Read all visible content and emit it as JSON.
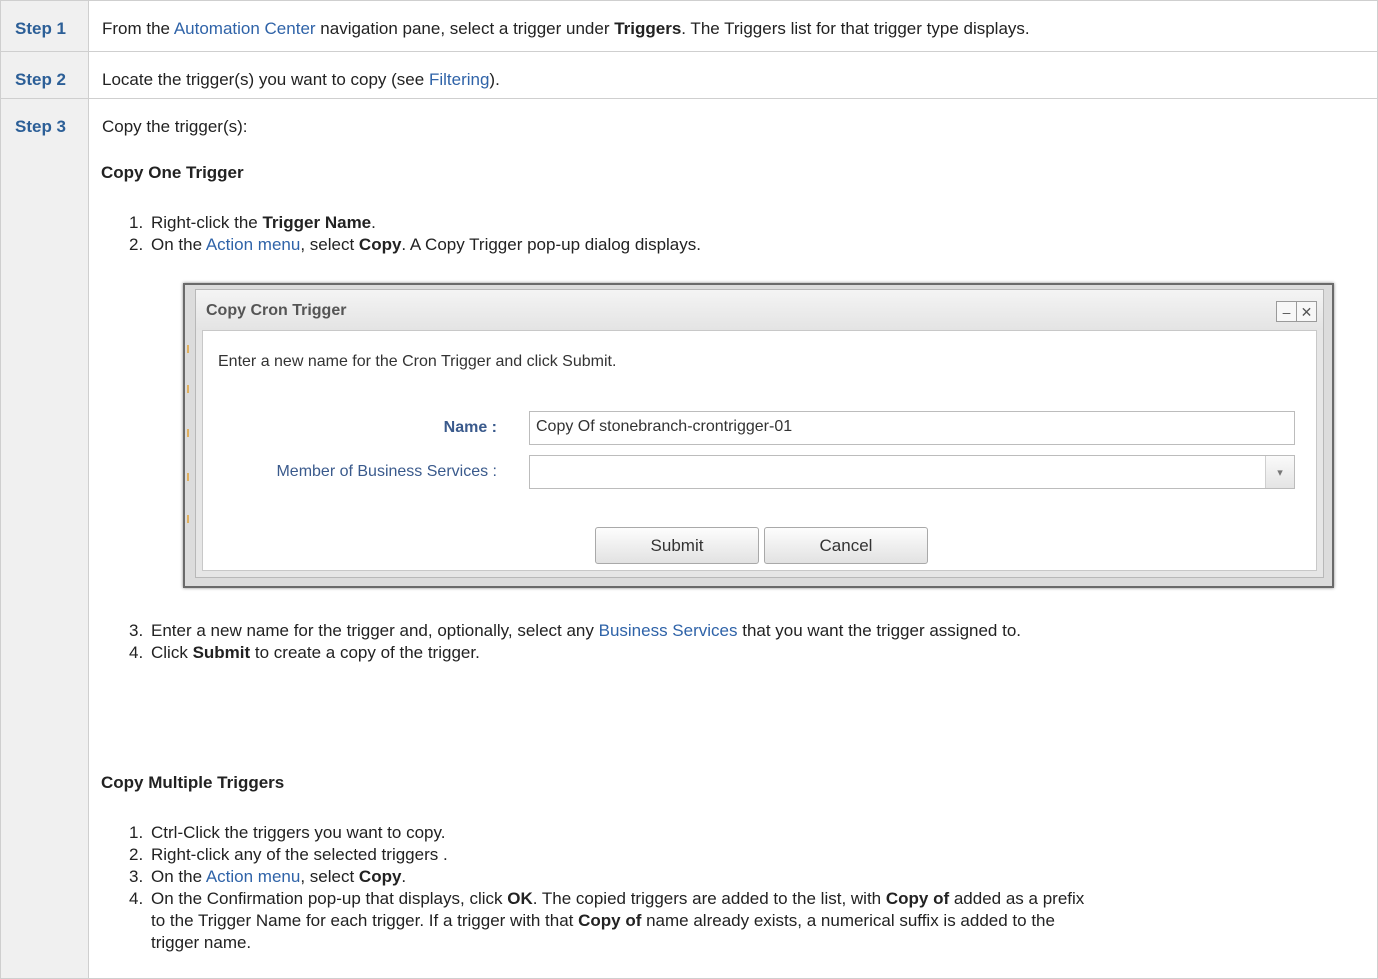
{
  "steps": [
    {
      "label": "Step 1",
      "parts": {
        "t1": "From the ",
        "link1": "Automation Center",
        "t2": " navigation pane, select a trigger under ",
        "b1": "Triggers",
        "t3": ". The Triggers list for that trigger type displays."
      }
    },
    {
      "label": "Step 2",
      "parts": {
        "t1": "Locate the trigger(s) you want to copy (see ",
        "link1": "Filtering",
        "t2": ")."
      }
    },
    {
      "label": "Step 3",
      "intro": "Copy the trigger(s):",
      "copy_one": {
        "heading": "Copy One Trigger",
        "items": [
          {
            "num": "1.",
            "t1": "Right-click the ",
            "b1": "Trigger Name",
            "t2": "."
          },
          {
            "num": "2.",
            "t1": "On the ",
            "link1": "Action menu",
            "t2": ", select ",
            "b1": "Copy",
            "t3": ". A Copy Trigger pop-up dialog displays."
          },
          {
            "num": "3.",
            "t1": "Enter a new name for the trigger and, optionally, select any ",
            "link1": "Business Services",
            "t2": " that you want the trigger assigned to."
          },
          {
            "num": "4.",
            "t1": "Click ",
            "b1": "Submit",
            "t2": " to create a copy of the trigger."
          }
        ]
      },
      "copy_multiple": {
        "heading": "Copy Multiple Triggers",
        "items": [
          {
            "num": "1.",
            "t1": "Ctrl-Click the triggers you want to copy."
          },
          {
            "num": "2.",
            "t1": "Right-click any of the selected triggers ."
          },
          {
            "num": "3.",
            "t1": "On the ",
            "link1": "Action menu",
            "t2": ", select ",
            "b1": "Copy",
            "t3": "."
          },
          {
            "num": "4.",
            "t1": "On the Confirmation pop-up that displays, click ",
            "b1": "OK",
            "t2": ". The copied triggers are added to the list, with ",
            "b2": "Copy of",
            "t3": " added as a prefix",
            "line2a": "to the Trigger Name for each trigger. If a trigger with that ",
            "b3": "Copy of",
            "line2b": " name already exists, a numerical suffix is added to the",
            "line3": "trigger name."
          }
        ]
      }
    }
  ],
  "dialog": {
    "title": "Copy Cron Trigger",
    "minimize_glyph": "–",
    "close_glyph": "✕",
    "instruction": "Enter a new name for the Cron Trigger and click Submit.",
    "name_label": "Name :",
    "name_value": "Copy Of stonebranch-crontrigger-01",
    "business_label": "Member of Business Services :",
    "business_value": "",
    "dropdown_glyph": "▾",
    "submit_label": "Submit",
    "cancel_label": "Cancel"
  },
  "colors": {
    "link": "#2f63a8",
    "step_label": "#2c5f97",
    "step_bg": "#f0f0f0",
    "border": "#cfcfcf"
  }
}
